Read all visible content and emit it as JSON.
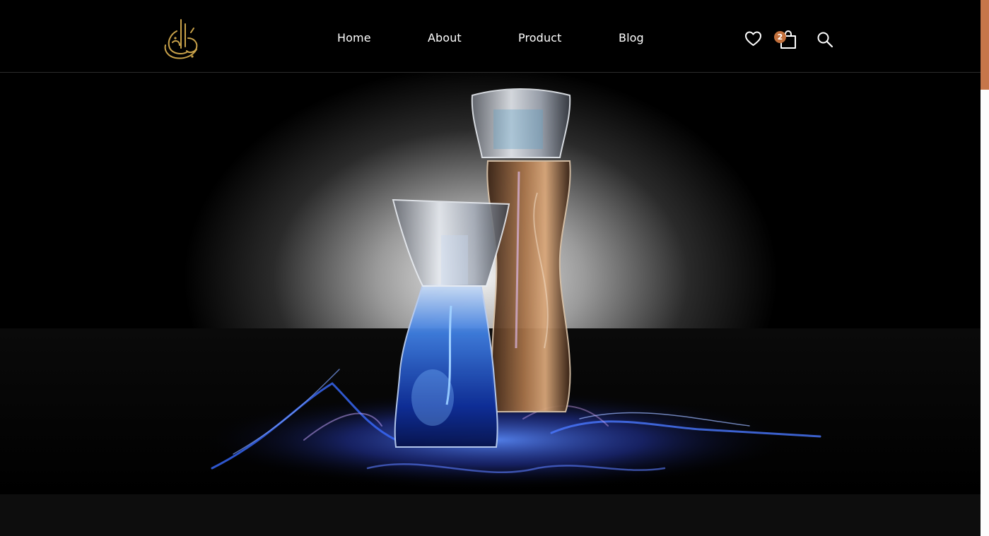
{
  "brand": {
    "logo_icon": "arabic-calligraphy-logo"
  },
  "nav": {
    "items": [
      {
        "label": "Home"
      },
      {
        "label": "About"
      },
      {
        "label": "Product"
      },
      {
        "label": "Blog"
      }
    ]
  },
  "header_icons": {
    "wishlist_icon": "heart-icon",
    "cart_icon": "shopping-bag-icon",
    "cart_count": "2",
    "search_icon": "search-icon"
  },
  "hero": {
    "image": "two-perfume-bottles-blue-flame"
  },
  "colors": {
    "accent": "#c2703c",
    "background": "#000000",
    "scroll_thumb": "#c6764a",
    "logo_gold": "#c9a24a"
  }
}
